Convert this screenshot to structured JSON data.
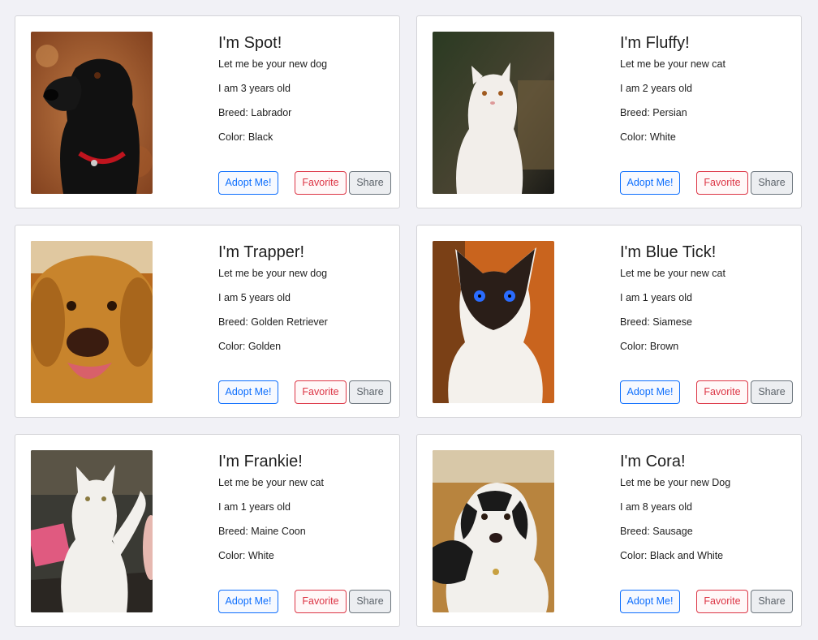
{
  "pets": [
    {
      "name": "I'm Spot!",
      "tagline": "Let me be your new dog",
      "age": "I am 3 years old",
      "breed": "Breed: Labrador",
      "color": "Color: Black",
      "photo": "black-labrador-photo"
    },
    {
      "name": "I'm Fluffy!",
      "tagline": "Let me be your new cat",
      "age": "I am 2 years old",
      "breed": "Breed: Persian",
      "color": "Color: White",
      "photo": "white-persian-cat-photo"
    },
    {
      "name": "I'm Trapper!",
      "tagline": "Let me be your new dog",
      "age": "I am 5 years old",
      "breed": "Breed: Golden Retriever",
      "color": "Color: Golden",
      "photo": "golden-retriever-photo"
    },
    {
      "name": "I'm Blue Tick!",
      "tagline": "Let me be your new cat",
      "age": "I am 1 years old",
      "breed": "Breed: Siamese",
      "color": "Color: Brown",
      "photo": "siamese-cat-photo"
    },
    {
      "name": "I'm Frankie!",
      "tagline": "Let me be your new cat",
      "age": "I am 1 years old",
      "breed": "Breed: Maine Coon",
      "color": "Color: White",
      "photo": "white-maine-coon-photo"
    },
    {
      "name": "I'm Cora!",
      "tagline": "Let me be your new Dog",
      "age": "I am 8 years old",
      "breed": "Breed: Sausage",
      "color": "Color: Black and White",
      "photo": "black-white-dog-photo"
    }
  ],
  "buttons": {
    "adopt": "Adopt Me!",
    "favorite": "Favorite",
    "share": "Share"
  },
  "colors": {
    "adopt": "#0d6efd",
    "favorite": "#dc3545",
    "share": "#6c757d",
    "page_background": "#f1f1f6"
  }
}
